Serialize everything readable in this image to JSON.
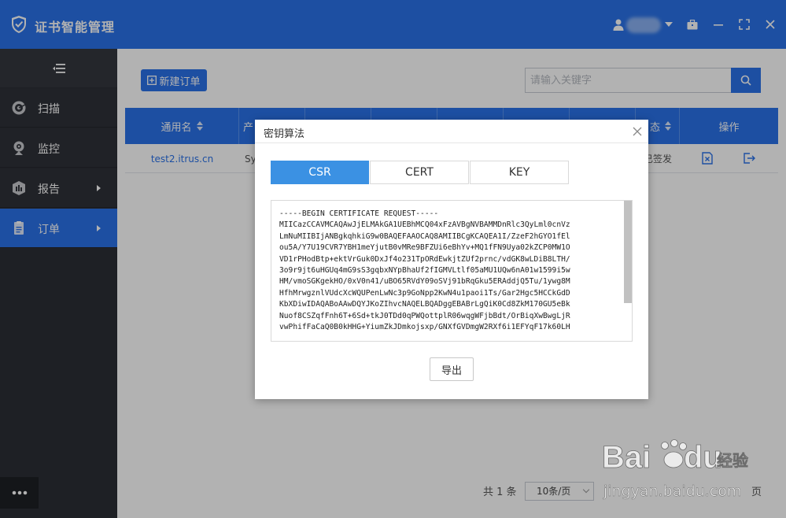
{
  "app": {
    "title": "证书智能管理",
    "username": ""
  },
  "colors": {
    "primary": "#2a72e8",
    "sidebar_bg": "#2b2e35",
    "tab_active": "#3b91e3"
  },
  "sidebar": {
    "items": [
      {
        "label": "扫描",
        "icon": "scan-icon",
        "has_arrow": false
      },
      {
        "label": "监控",
        "icon": "webcam-icon",
        "has_arrow": false
      },
      {
        "label": "报告",
        "icon": "report-icon",
        "has_arrow": true
      },
      {
        "label": "订单",
        "icon": "order-icon",
        "has_arrow": true,
        "active": true
      }
    ]
  },
  "toolbar": {
    "new_order_label": "新建订单",
    "search_placeholder": "请输入关键字"
  },
  "table": {
    "columns": [
      "通用名",
      "产",
      "",
      "",
      "",
      "",
      "",
      "态",
      "操作"
    ],
    "rows": [
      {
        "common_name": "test2.itrus.cn",
        "product": "Sy",
        "status": "已签发"
      }
    ]
  },
  "pagination": {
    "total_text": "共 1 条",
    "page_size": "10条/页",
    "suffix": "页"
  },
  "modal": {
    "title": "密钥算法",
    "tabs": [
      "CSR",
      "CERT",
      "KEY"
    ],
    "active_tab": "CSR",
    "code_lines": [
      "-----BEGIN CERTIFICATE REQUEST-----",
      "MIICazCCAVMCAQAwJjELMAkGA1UEBhMCQ04xFzAVBgNVBAMMDnRlc3QyLml0cnVz",
      "LmNuMIIBIjANBgkqhkiG9w0BAQEFAAOCAQ8AMIIBCgKCAQEA1I/ZzeF2hGYO1fEl",
      "ou5A/Y7U19CVR7YBH1meYjutB0vMRe9BFZUi6eBhYv+MQ1fFN9Uya02kZCP0MW1O",
      "VD1rPHodBtp+ektVrGuk0DxJf4o231TpORdEwkjtZUf2prnc/vdGK8wLDiB8LTH/",
      "3o9r9jt6uHGUq4mG9sS3gqbxNYpBhaUf2fIGMVLtlf05aMU1UQw6nA01w1599i5w",
      "HM/vmoSGKgekHO/0xV0n41/uBO65RVdY09oSVj91bRqGku5ERAddjQ5Tu/1ywg8M",
      "HfhMrwgznlVUdcXcWQUPenLwNc3p9GoNpp2KwN4u1paoi1Ts/Gar2Hgc5HCCkGdD",
      "KbXDiwIDAQABoAAwDQYJKoZIhvcNAQELBQADggEBABrLgQiK0Cd8ZkM170GU5eBk",
      "Nuof8CSZqfFnh6T+6Sd+tkJ0TDd0qPWQottplR06wqgWFjbBdt/OrBiqXwBwgLjR",
      "vwPhifFaCaQ0B0kHHG+YiumZkJDmkojsxp/GNXfGVDmgW2RXf6i1EFYqF17k60LH"
    ],
    "export_label": "导出"
  },
  "watermark": {
    "brand": "Bai",
    "brand_tail": "du",
    "cn": "经验",
    "url": "jingyan.baidu.com"
  }
}
